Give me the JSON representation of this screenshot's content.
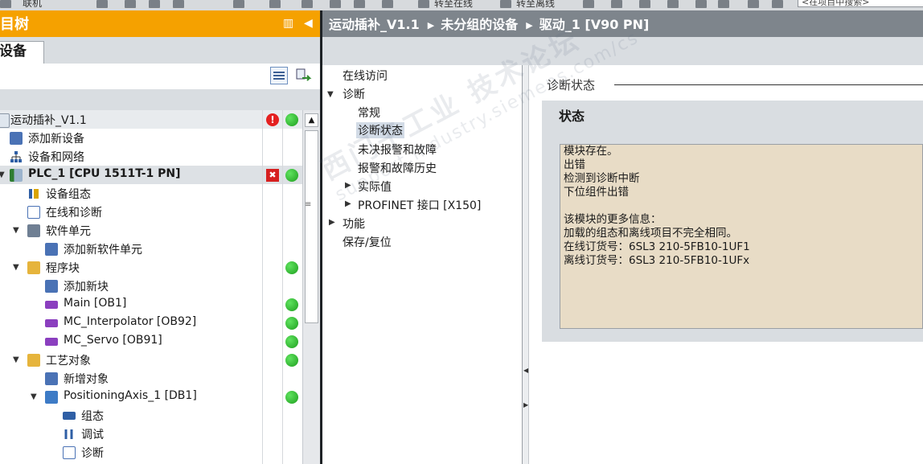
{
  "toolbar": {
    "label1": "联机",
    "label2": "转至在线",
    "label3": "转至离线",
    "search_placeholder": "<在项目中搜索>"
  },
  "project_tree": {
    "title": "目树",
    "tab": "设备",
    "items": [
      {
        "label": "运动插补_V1.1",
        "status": [
          "error",
          "ok"
        ]
      },
      {
        "label": "添加新设备",
        "status": []
      },
      {
        "label": "设备和网络",
        "status": []
      },
      {
        "label": "PLC_1 [CPU 1511T-1 PN]",
        "status": [
          "maintenance",
          "ok"
        ]
      },
      {
        "label": "设备组态",
        "status": []
      },
      {
        "label": "在线和诊断",
        "status": []
      },
      {
        "label": "软件单元",
        "status": []
      },
      {
        "label": "添加新软件单元",
        "status": []
      },
      {
        "label": "程序块",
        "status": [
          "ok"
        ]
      },
      {
        "label": "添加新块",
        "status": []
      },
      {
        "label": "Main [OB1]",
        "status": [
          "ok"
        ]
      },
      {
        "label": "MC_Interpolator [OB92]",
        "status": [
          "ok"
        ]
      },
      {
        "label": "MC_Servo [OB91]",
        "status": [
          "ok"
        ]
      },
      {
        "label": "工艺对象",
        "status": [
          "ok"
        ]
      },
      {
        "label": "新增对象",
        "status": []
      },
      {
        "label": "PositioningAxis_1 [DB1]",
        "status": [
          "ok"
        ]
      },
      {
        "label": "组态",
        "status": []
      },
      {
        "label": "调试",
        "status": []
      },
      {
        "label": "诊断",
        "status": []
      }
    ]
  },
  "breadcrumb": [
    "运动插补_V1.1",
    "未分组的设备",
    "驱动_1 [V90 PN]"
  ],
  "nav": {
    "online_access": "在线访问",
    "diagnostics": "诊断",
    "general": "常规",
    "diag_status": "诊断状态",
    "pending_alarms": "未决报警和故障",
    "alarm_history": "报警和故障历史",
    "actual_values": "实际值",
    "profinet": "PROFINET 接口 [X150]",
    "functions": "功能",
    "save_reset": "保存/复位"
  },
  "content": {
    "section_title": "诊断状态",
    "status_title": "状态",
    "lines": [
      "模块存在。",
      "出错",
      "检测到诊断中断",
      "下位组件出错",
      "",
      "该模块的更多信息：",
      "加载的组态和离线项目不完全相同。",
      "在线订货号：6SL3 210-5FB10-1UF1",
      "离线订货号：6SL3 210-5FB10-1UFx"
    ]
  },
  "watermark": {
    "line1": "西门子工业 技术论坛",
    "line2": "support.industry.siemens.com/cs"
  },
  "colors": {
    "accent_orange": "#f5a100",
    "header_gray": "#7e858c",
    "status_bg": "#e8dcc6",
    "ok_green": "#1e9e1e",
    "error_red": "#e42020"
  }
}
